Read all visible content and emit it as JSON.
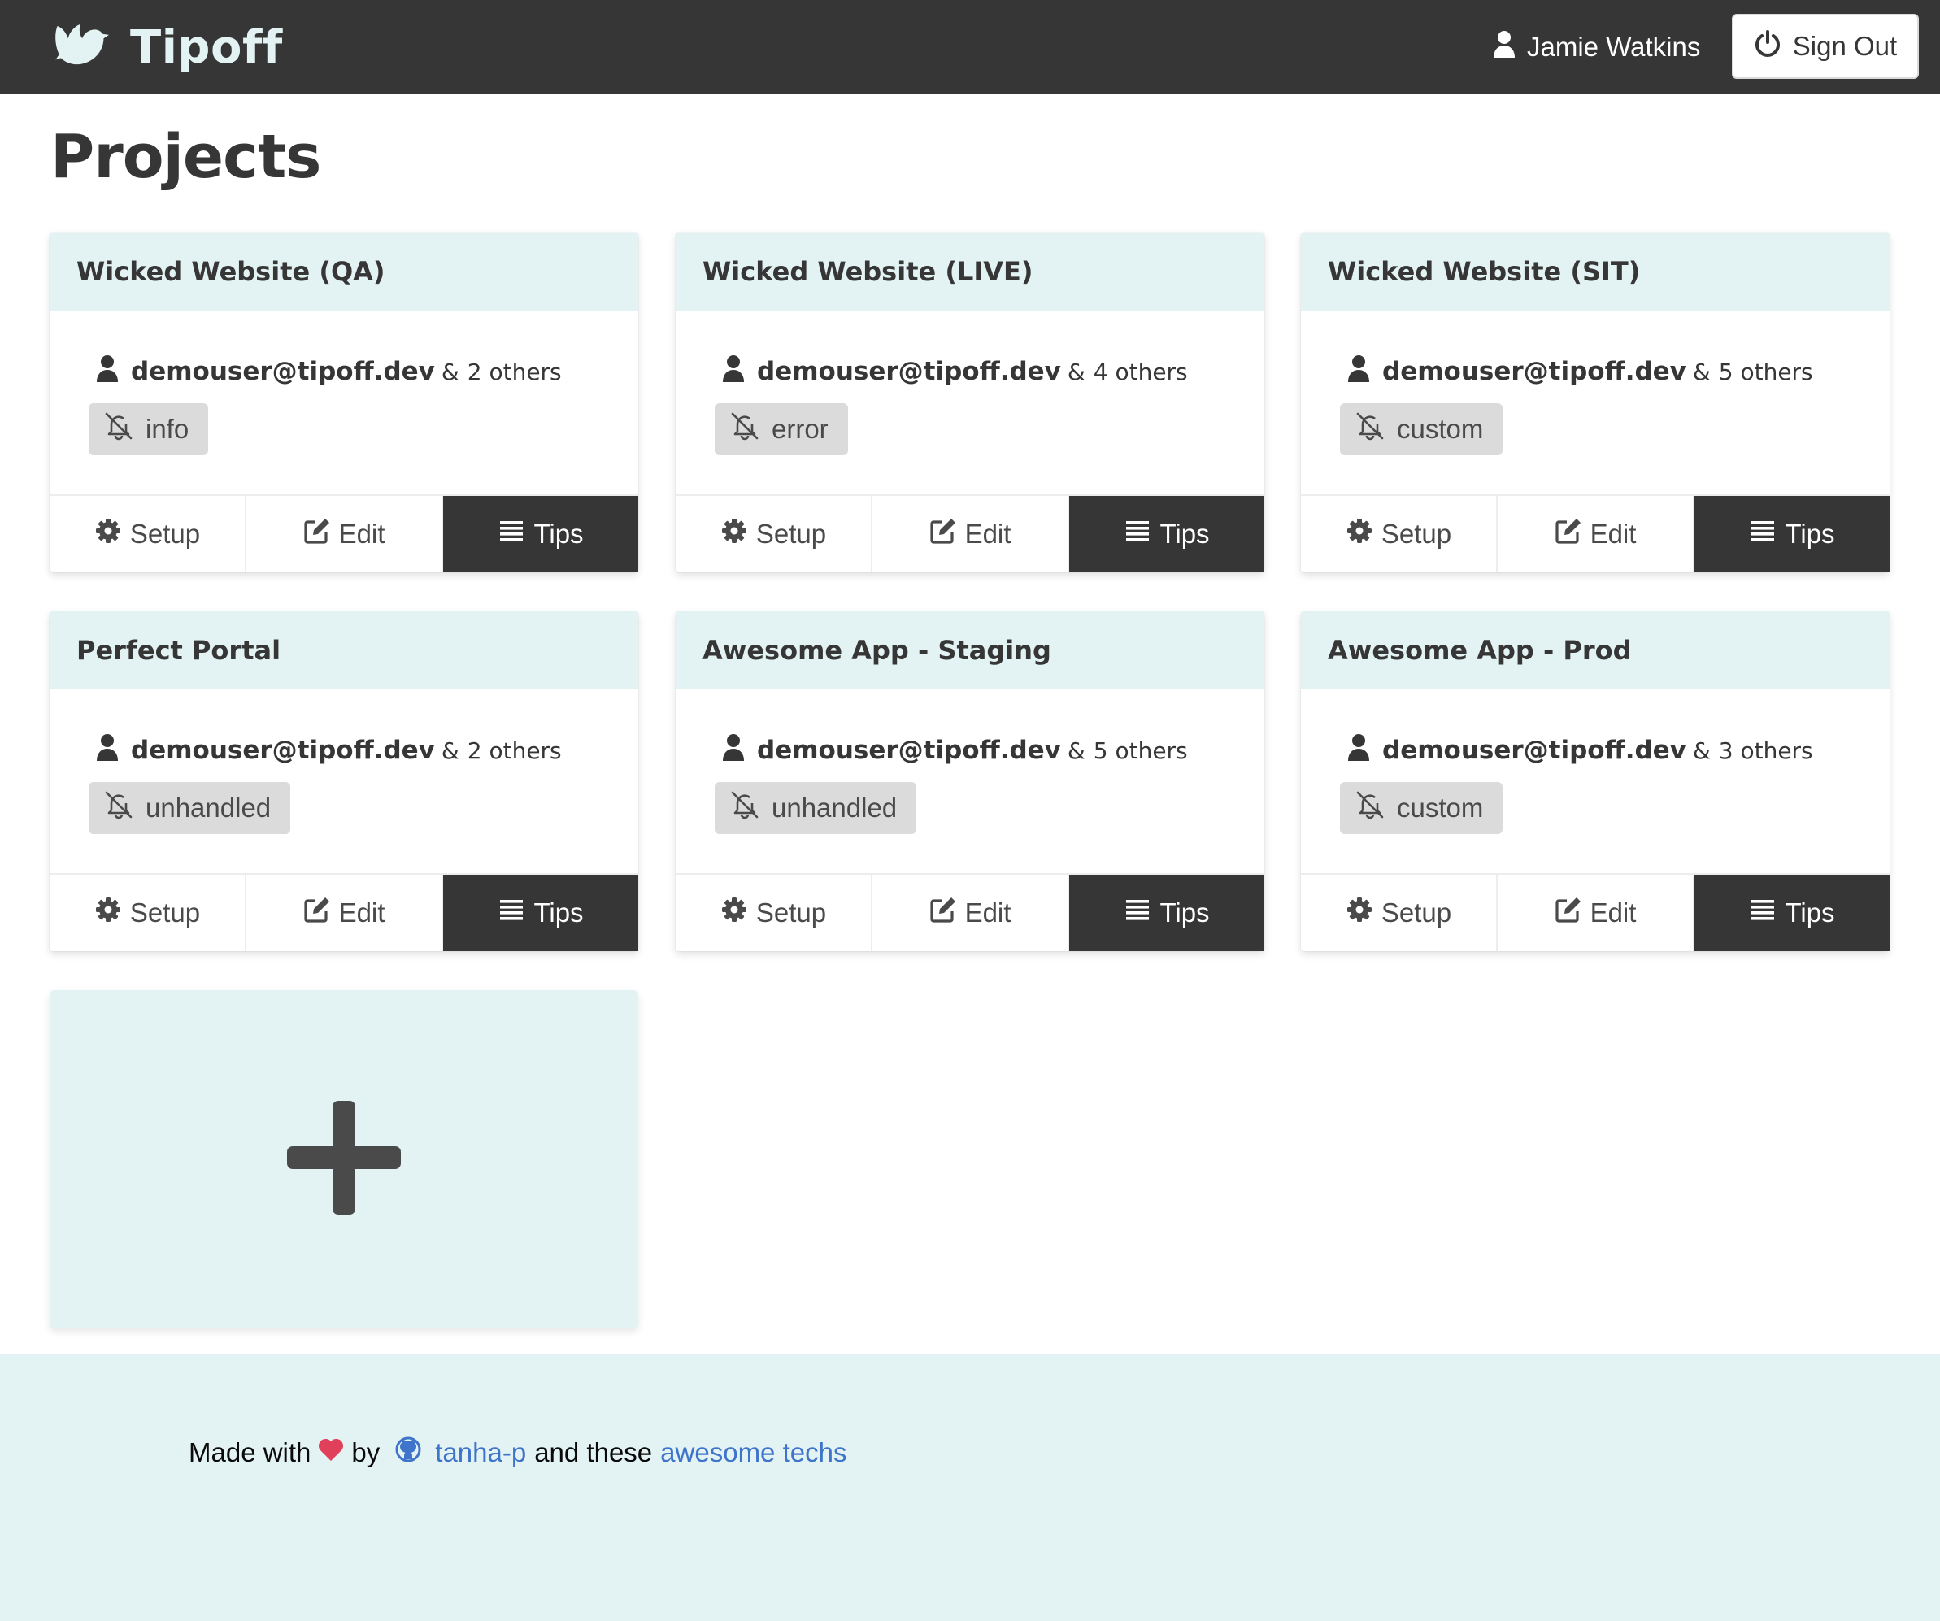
{
  "header": {
    "brand": "Tipoff",
    "user_name": "Jamie Watkins",
    "signout_label": "Sign Out"
  },
  "page_title": "Projects",
  "projects": [
    {
      "name": "Wicked Website (QA)",
      "owner": "demouser@tipoff.dev",
      "amp": "&",
      "others": "2 others",
      "level": "info",
      "setup_label": "Setup",
      "edit_label": "Edit",
      "tips_label": "Tips"
    },
    {
      "name": "Wicked Website (LIVE)",
      "owner": "demouser@tipoff.dev",
      "amp": "&",
      "others": "4 others",
      "level": "error",
      "setup_label": "Setup",
      "edit_label": "Edit",
      "tips_label": "Tips"
    },
    {
      "name": "Wicked Website (SIT)",
      "owner": "demouser@tipoff.dev",
      "amp": "&",
      "others": "5 others",
      "level": "custom",
      "setup_label": "Setup",
      "edit_label": "Edit",
      "tips_label": "Tips"
    },
    {
      "name": "Perfect Portal",
      "owner": "demouser@tipoff.dev",
      "amp": "&",
      "others": "2 others",
      "level": "unhandled",
      "setup_label": "Setup",
      "edit_label": "Edit",
      "tips_label": "Tips"
    },
    {
      "name": "Awesome App - Staging",
      "owner": "demouser@tipoff.dev",
      "amp": "&",
      "others": "5 others",
      "level": "unhandled",
      "setup_label": "Setup",
      "edit_label": "Edit",
      "tips_label": "Tips"
    },
    {
      "name": "Awesome App - Prod",
      "owner": "demouser@tipoff.dev",
      "amp": "&",
      "others": "3 others",
      "level": "custom",
      "setup_label": "Setup",
      "edit_label": "Edit",
      "tips_label": "Tips"
    }
  ],
  "footer": {
    "made_with": "Made with",
    "by": "by",
    "author_link": "tanha-p",
    "and_these": "and these",
    "techs_link": "awesome techs"
  },
  "icons": {
    "brand": "dove-icon",
    "user": "user-icon",
    "signout": "power-icon",
    "level": "bell-slash-icon",
    "setup": "cog-icon",
    "edit": "edit-icon",
    "tips": "list-icon",
    "add": "plus-icon",
    "heart": "heart-icon",
    "github": "github-icon"
  },
  "colors": {
    "navbar": "#363636",
    "accent_light": "#e3f2f3",
    "tips_bg": "#363636",
    "tag_bg": "#dbdbdb",
    "link": "#3e74c9",
    "heart": "#e0405a"
  }
}
